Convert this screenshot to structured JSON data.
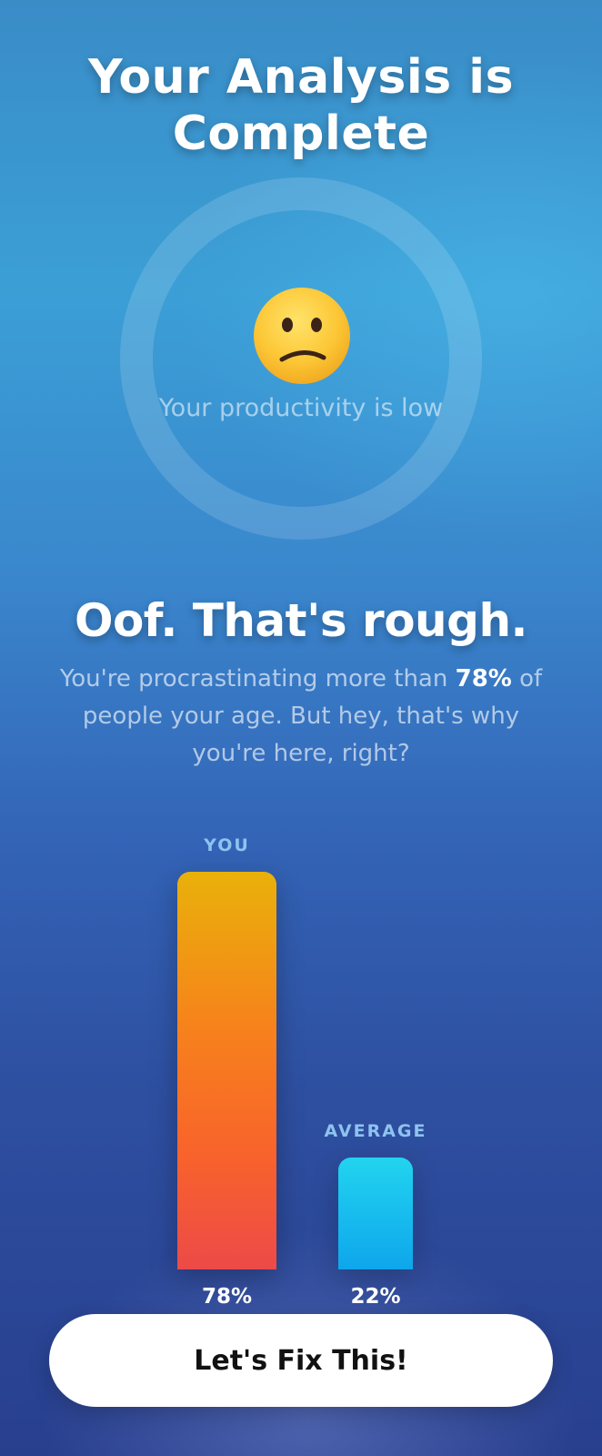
{
  "header": {
    "title_line1": "Your Analysis is",
    "title_line2": "Complete"
  },
  "result_ring": {
    "emoji": "confused-face-emoji",
    "caption": "Your productivity is low"
  },
  "summary": {
    "headline": "Oof. That's rough.",
    "text_before": "You're procrastinating more than ",
    "highlight": "78%",
    "text_after": " of people your age. But hey, that's why you're here, right?"
  },
  "chart_data": {
    "type": "bar",
    "categories": [
      "YOU",
      "AVERAGE"
    ],
    "values": [
      78,
      22
    ],
    "value_labels": [
      "78%",
      "22%"
    ],
    "ylim": [
      0,
      100
    ],
    "colors": [
      "#f8622c",
      "#0ea6ec"
    ]
  },
  "cta": {
    "label": "Let's Fix This!"
  }
}
